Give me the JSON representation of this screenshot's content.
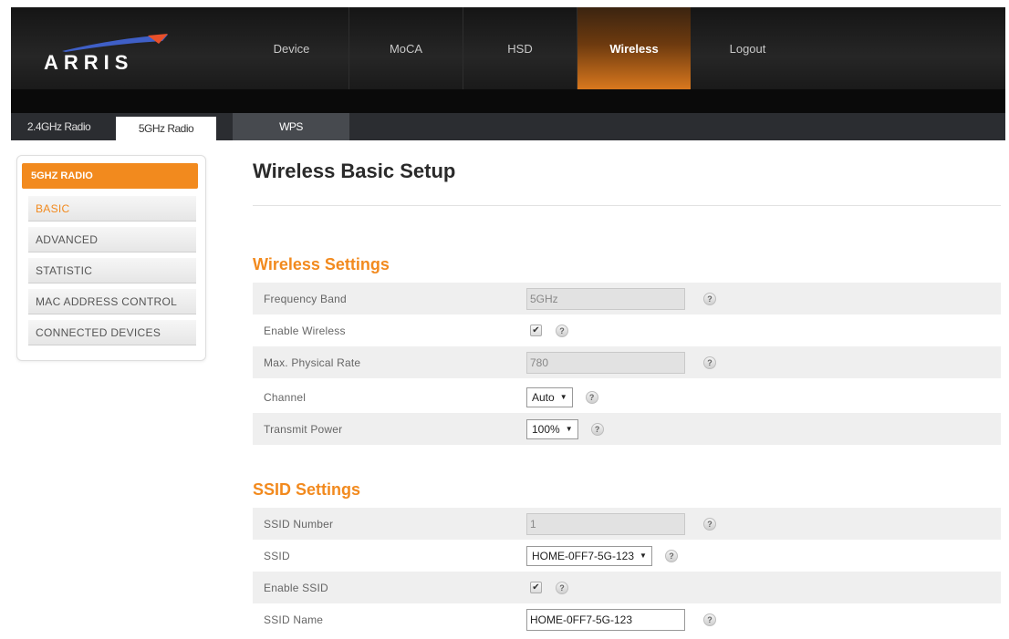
{
  "brand": {
    "logo_text": "ARRIS"
  },
  "topnav": {
    "items": [
      {
        "label": "Device"
      },
      {
        "label": "MoCA"
      },
      {
        "label": "HSD"
      },
      {
        "label": "Wireless"
      },
      {
        "label": "Logout"
      }
    ],
    "active": "Wireless"
  },
  "subtabs": {
    "items": [
      {
        "label": "2.4GHz Radio"
      },
      {
        "label": "5GHz Radio"
      },
      {
        "label": "WPS"
      }
    ],
    "active": "5GHz Radio"
  },
  "sidebar": {
    "heading": "5GHZ RADIO",
    "items": [
      {
        "label": "BASIC"
      },
      {
        "label": "ADVANCED"
      },
      {
        "label": "STATISTIC"
      },
      {
        "label": "MAC ADDRESS CONTROL"
      },
      {
        "label": "CONNECTED DEVICES"
      }
    ],
    "active": "BASIC"
  },
  "page": {
    "title": "Wireless Basic Setup"
  },
  "wireless_settings": {
    "title": "Wireless Settings",
    "frequency_band": {
      "label": "Frequency Band",
      "value": "5GHz"
    },
    "enable_wireless": {
      "label": "Enable Wireless",
      "checked": true
    },
    "max_physical_rate": {
      "label": "Max. Physical Rate",
      "value": "780"
    },
    "channel": {
      "label": "Channel",
      "value": "Auto"
    },
    "transmit_power": {
      "label": "Transmit Power",
      "value": "100%"
    }
  },
  "ssid_settings": {
    "title": "SSID Settings",
    "ssid_number": {
      "label": "SSID Number",
      "value": "1"
    },
    "ssid": {
      "label": "SSID",
      "value": "HOME-0FF7-5G-123"
    },
    "enable_ssid": {
      "label": "Enable SSID",
      "checked": true
    },
    "ssid_name": {
      "label": "SSID Name",
      "value": "HOME-0FF7-5G-123"
    }
  },
  "glyphs": {
    "checkmark": "✔",
    "help": "?",
    "caret": "▼"
  },
  "colors": {
    "accent_orange": "#f28a1e",
    "header_dark": "#1a1a1a",
    "subtab_bar": "#2b2d31"
  }
}
